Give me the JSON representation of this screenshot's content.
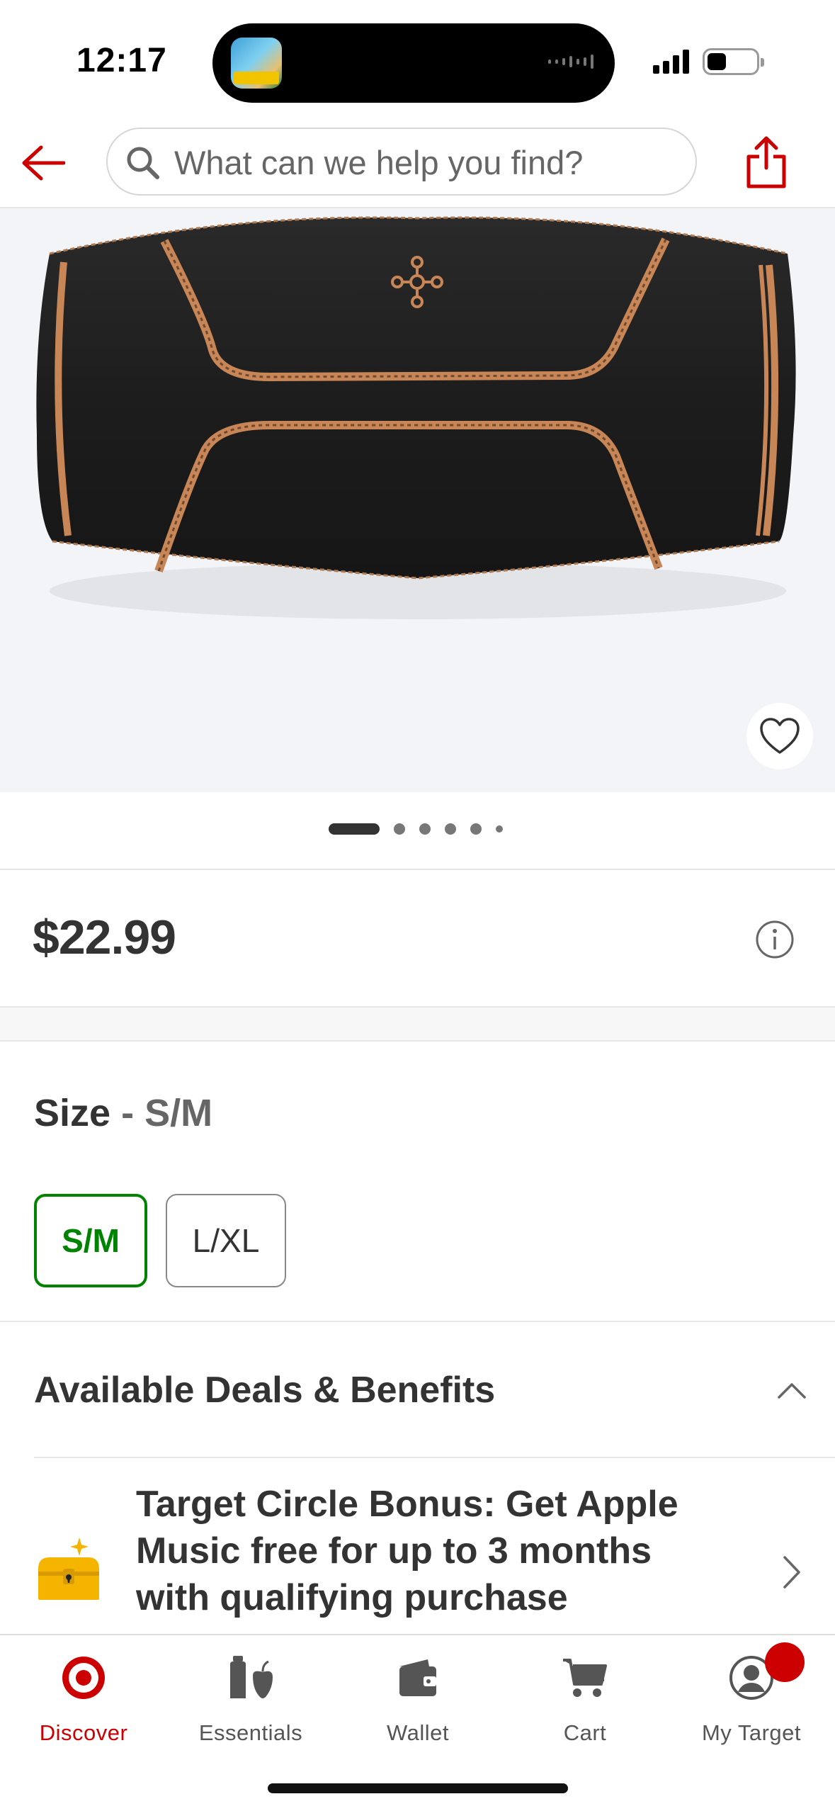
{
  "status_bar": {
    "time": "12:17"
  },
  "header": {
    "search_placeholder": "What can we help you find?"
  },
  "product": {
    "price": "$22.99",
    "image_count": 6,
    "current_image": 1
  },
  "size": {
    "label": "Size",
    "separator": " - ",
    "selected": "S/M",
    "options": [
      "S/M",
      "L/XL"
    ]
  },
  "deals": {
    "title": "Available Deals & Benefits",
    "items": [
      {
        "text": "Target Circle Bonus: Get Apple Music free for up to 3 months with qualifying purchase"
      }
    ]
  },
  "tab_bar": {
    "tabs": [
      {
        "label": "Discover"
      },
      {
        "label": "Essentials"
      },
      {
        "label": "Wallet"
      },
      {
        "label": "Cart"
      },
      {
        "label": "My Target"
      }
    ],
    "active": "Discover"
  },
  "colors": {
    "brand_red": "#cc0000",
    "selected_green": "#008300",
    "text_dark": "#333333",
    "image_background": "#f3f4f7"
  },
  "icons": [
    "back-arrow-icon",
    "search-icon",
    "share-icon",
    "heart-icon",
    "info-icon",
    "chevron-up-icon",
    "treasure-chest-icon",
    "chevron-right-icon",
    "target-bullseye-icon",
    "essentials-icon",
    "wallet-icon",
    "cart-icon",
    "account-icon"
  ]
}
